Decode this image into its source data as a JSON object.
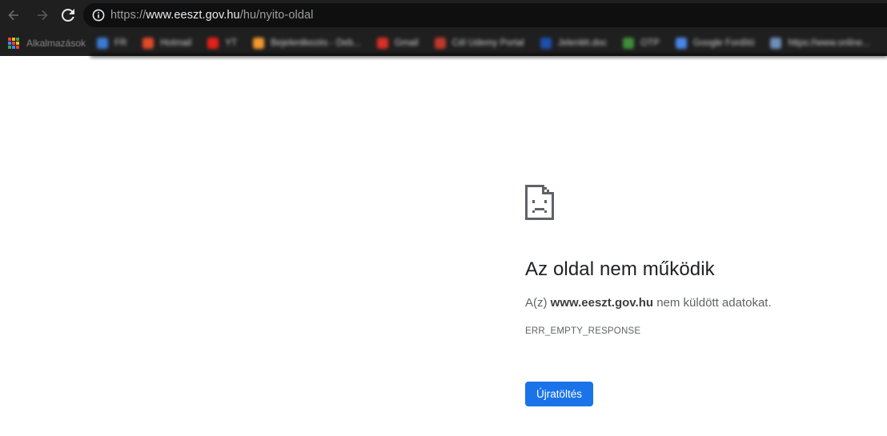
{
  "toolbar": {
    "back_icon": "arrow-left-icon",
    "forward_icon": "arrow-right-icon",
    "reload_icon": "reload-icon",
    "info_icon": "info-icon"
  },
  "address_bar": {
    "scheme": "https://",
    "host": "www.eeszt.gov.hu",
    "path": "/hu/nyito-oldal"
  },
  "bookmarks": {
    "apps_label": "Alkalmazások",
    "items": [
      {
        "label": "FR",
        "color": "#3b7bd5"
      },
      {
        "label": "Hotmail",
        "color": "#e04b2a"
      },
      {
        "label": "YT",
        "color": "#e62117"
      },
      {
        "label": "Bejelentkezés - Deb...",
        "color": "#f29a2e"
      },
      {
        "label": "Gmail",
        "color": "#d93025"
      },
      {
        "label": "Cél Udemy Portal",
        "color": "#c0392b"
      },
      {
        "label": "Jelenlét.doc",
        "color": "#1f4fb0"
      },
      {
        "label": "OTP",
        "color": "#3f8f3a"
      },
      {
        "label": "Google Fordító",
        "color": "#4a86e8"
      },
      {
        "label": "https://www.online...",
        "color": "#6d8fb8"
      }
    ]
  },
  "error": {
    "icon": "sad-page-icon",
    "title": "Az oldal nem működik",
    "desc_prefix": "A(z) ",
    "desc_host": "www.eeszt.gov.hu",
    "desc_suffix": " nem küldött adatokat.",
    "code": "ERR_EMPTY_RESPONSE",
    "reload_label": "Újratöltés"
  },
  "colors": {
    "toolbar_bg": "#1f1f1f",
    "omnibox_bg": "#0f0f0f",
    "button_blue": "#1a73e8",
    "title_text": "#202124",
    "body_text": "#5f6368"
  }
}
